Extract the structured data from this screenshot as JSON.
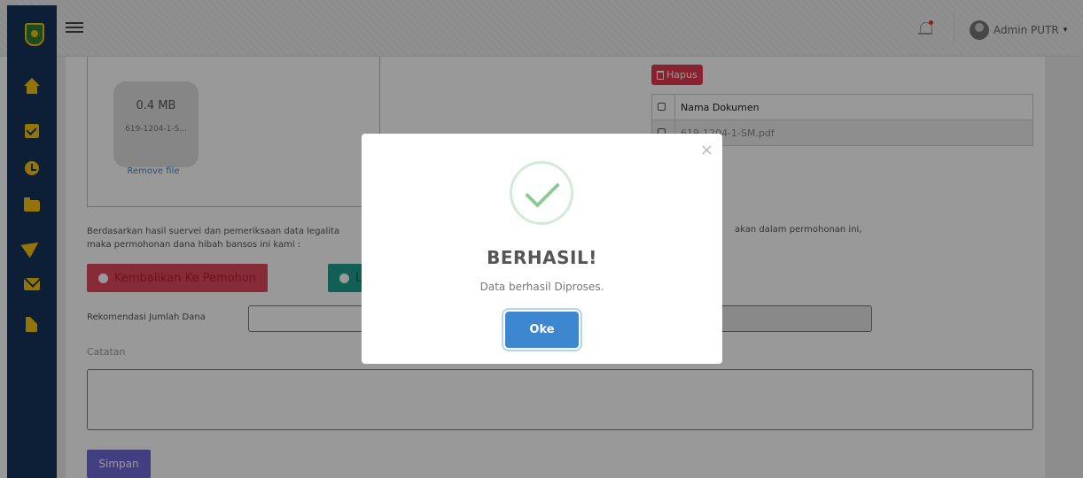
{
  "header": {
    "user_name": "Admin PUTR",
    "caret": "▾"
  },
  "upload": {
    "file_size": "0.4 MB",
    "file_name": "619-1204-1-S...",
    "remove_label": "Remove file"
  },
  "documents": {
    "delete_label": "Hapus",
    "column_header": "Nama Dokumen",
    "rows": [
      {
        "name": "619-1204-1-SM.pdf"
      }
    ]
  },
  "form": {
    "description_line1": "Berdasarkan hasil suervei dan pemeriksaan data legalita",
    "description_line1_tail": "akan dalam permohonan ini,",
    "description_line2": "maka permohonan dana hibah bansos ini kami :",
    "option_return": "Kembalikan Ke Pemohon",
    "option_continue": "L",
    "recommend_label": "Rekomendasi Jumlah Dana",
    "notes_label": "Catatan",
    "save_label": "Simpan"
  },
  "modal": {
    "title": "BERHASIL!",
    "message": "Data berhasil Diproses.",
    "ok_label": "Oke",
    "close_glyph": "×"
  },
  "colors": {
    "sidebar": "#14345a",
    "icon_accent": "#f4c20d",
    "danger": "#e53950",
    "success": "#1ea08e",
    "primary": "#3d86d0",
    "save": "#6f68d4"
  }
}
